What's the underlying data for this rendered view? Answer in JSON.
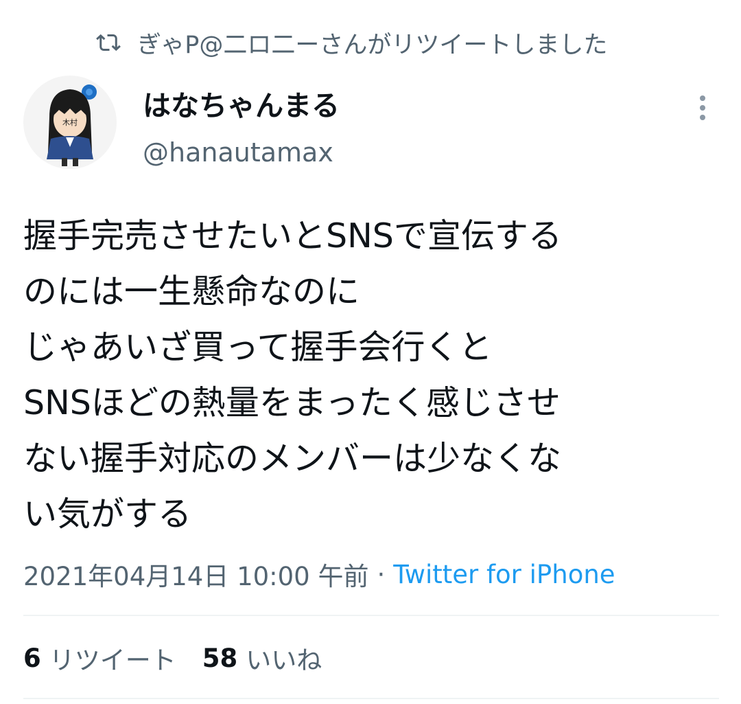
{
  "retweet_notice": {
    "text": "ぎゃP@二ロ二ーさんがリツイートしました",
    "icon": "retweet-icon"
  },
  "tweet": {
    "author": {
      "display_name": "はなちゃんまる",
      "handle": "@hanautamax",
      "avatar_label": "木村"
    },
    "text_lines": [
      "握手完売させたいとSNSで宣伝する",
      "のには一生懸命なのに",
      "じゃあいざ買って握手会行くと",
      "SNSほどの熱量をまったく感じさせ",
      "ない握手対応のメンバーは少なくな",
      "い気がする"
    ],
    "timestamp": "2021年04月14日 10:00 午前",
    "separator": "·",
    "source": "Twitter for iPhone",
    "stats": {
      "retweets_count": "6",
      "retweets_label": "リツイート",
      "likes_count": "58",
      "likes_label": "いいね"
    }
  },
  "colors": {
    "text_primary": "#0f1419",
    "text_secondary": "#536471",
    "link": "#1d9bf0",
    "divider": "#eff3f4"
  }
}
